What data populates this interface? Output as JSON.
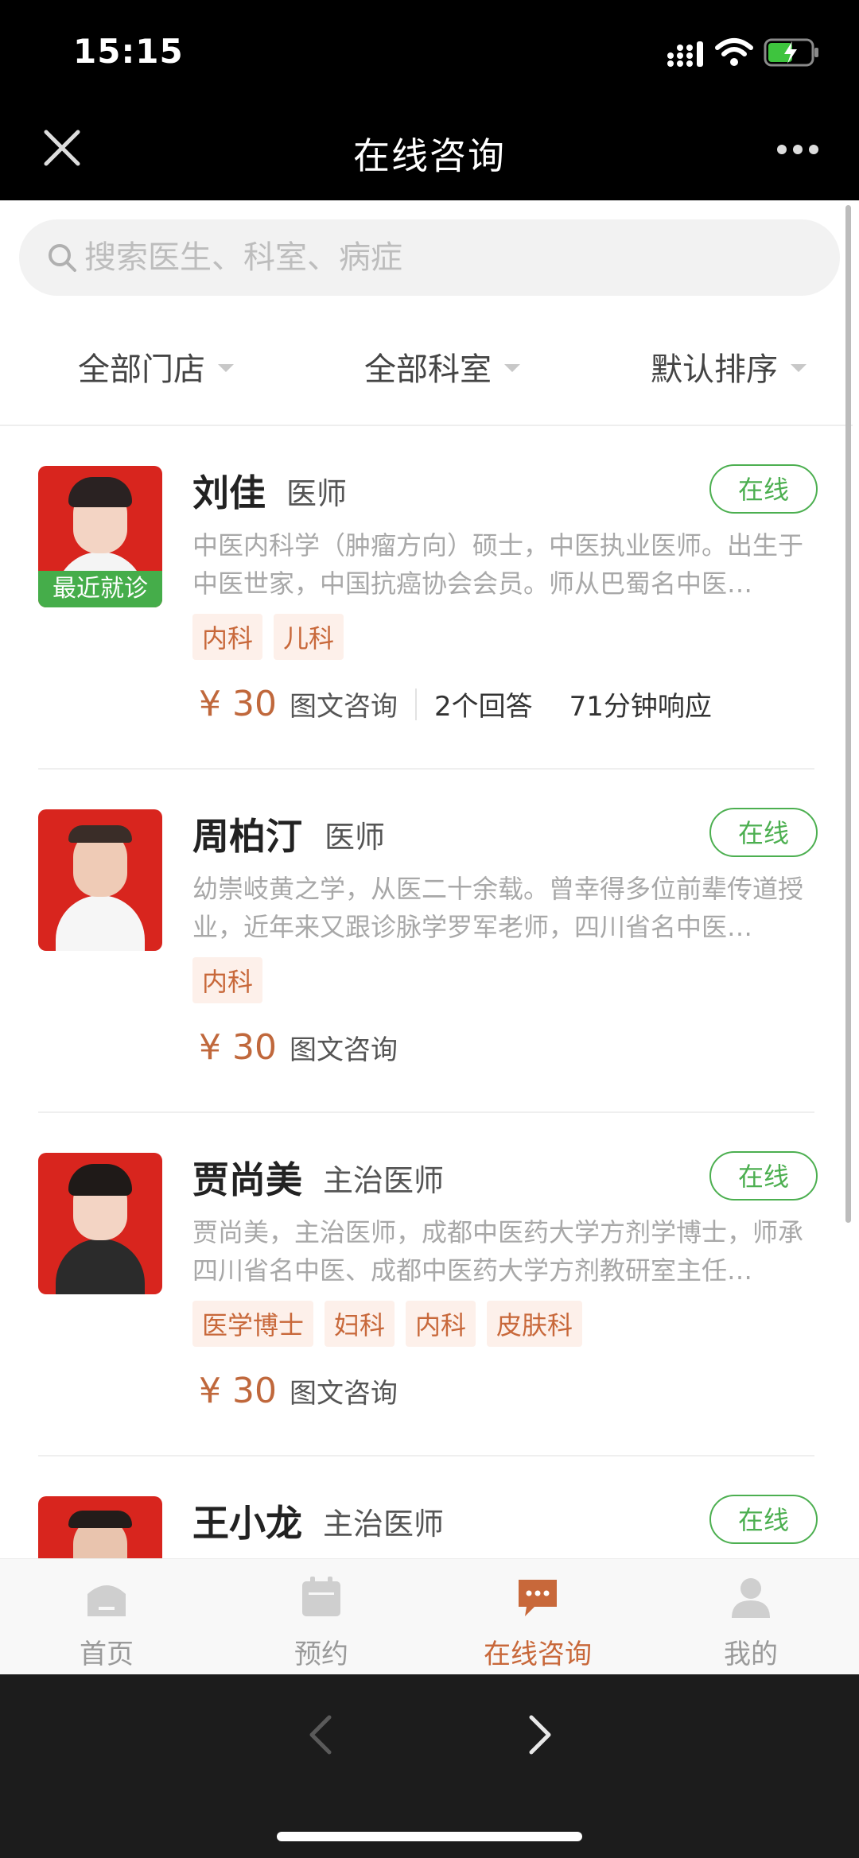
{
  "status": {
    "time": "15:15"
  },
  "nav": {
    "title": "在线咨询"
  },
  "search": {
    "placeholder": "搜索医生、科室、病症"
  },
  "filters": [
    "全部门店",
    "全部科室",
    "默认排序"
  ],
  "doctors": [
    {
      "name": "刘佳",
      "title": "医师",
      "badge": "最近就诊",
      "status": "在线",
      "desc": "中医内科学（肿瘤方向）硕士，中医执业医师。出生于中医世家，中国抗癌协会会员。师从巴蜀名中医…",
      "tags": [
        "内科",
        "儿科"
      ],
      "price": "¥ 30",
      "consult_type": "图文咨询",
      "answers": "2个回答",
      "response": "71分钟响应"
    },
    {
      "name": "周柏汀",
      "title": "医师",
      "status": "在线",
      "desc": "幼崇岐黄之学，从医二十余载。曾幸得多位前辈传道授业，近年来又跟诊脉学罗军老师，四川省名中医…",
      "tags": [
        "内科"
      ],
      "price": "¥ 30",
      "consult_type": "图文咨询"
    },
    {
      "name": "贾尚美",
      "title": "主治医师",
      "status": "在线",
      "desc": "贾尚美，主治医师，成都中医药大学方剂学博士，师承四川省名中医、成都中医药大学方剂教研室主任…",
      "tags": [
        "医学博士",
        "妇科",
        "内科",
        "皮肤科"
      ],
      "price": "¥ 30",
      "consult_type": "图文咨询"
    },
    {
      "name": "王小龙",
      "title": "主治医师",
      "status": "在线"
    }
  ],
  "tabs": [
    {
      "label": "首页",
      "icon": "home-icon"
    },
    {
      "label": "预约",
      "icon": "calendar-icon"
    },
    {
      "label": "在线咨询",
      "icon": "chat-icon",
      "active": true
    },
    {
      "label": "我的",
      "icon": "person-icon"
    }
  ],
  "colors": {
    "accent": "#c8683a",
    "online": "#4caf50",
    "badge": "#45ad4a"
  }
}
